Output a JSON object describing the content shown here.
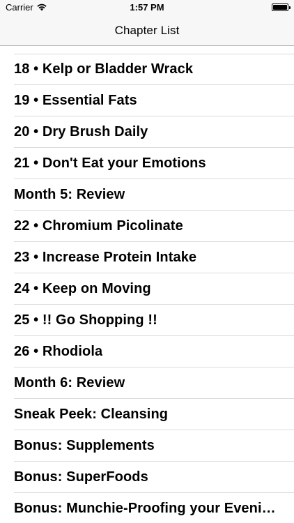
{
  "status_bar": {
    "carrier": "Carrier",
    "time": "1:57 PM",
    "icons": [
      "wifi-icon",
      "battery-icon"
    ]
  },
  "nav_bar": {
    "title": "Chapter List"
  },
  "chapters": [
    "18 • Kelp or Bladder Wrack",
    "19 • Essential Fats",
    "20 • Dry Brush Daily",
    "21 • Don't Eat your Emotions",
    "Month 5: Review",
    "22 • Chromium Picolinate",
    "23 • Increase Protein Intake",
    "24 • Keep on Moving",
    "25 • !! Go Shopping !!",
    "26 • Rhodiola",
    "Month 6: Review",
    "Sneak Peek: Cleansing",
    "Bonus: Supplements",
    "Bonus: SuperFoods",
    "Bonus: Munchie-Proofing your Evenings"
  ]
}
